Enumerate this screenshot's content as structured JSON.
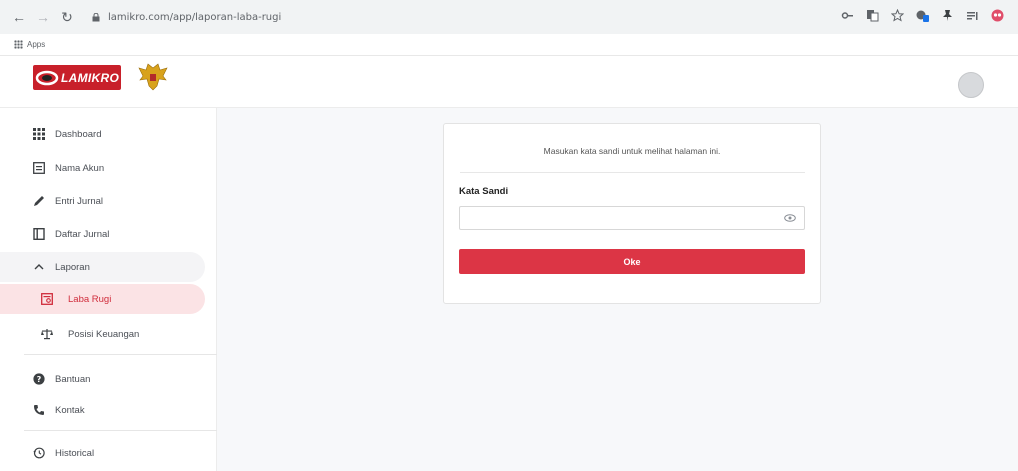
{
  "browser": {
    "url": "lamikro.com/app/laporan-laba-rugi",
    "bookmarks": {
      "apps_label": "Apps"
    }
  },
  "header": {
    "logo_text": "LAMIKRO"
  },
  "sidebar": {
    "items": [
      {
        "label": "Dashboard",
        "icon": "grid-icon"
      },
      {
        "label": "Nama Akun",
        "icon": "list-icon"
      },
      {
        "label": "Entri Jurnal",
        "icon": "pencil-icon"
      },
      {
        "label": "Daftar Jurnal",
        "icon": "book-icon"
      },
      {
        "label": "Laporan",
        "icon": "chevron-up-icon"
      },
      {
        "label": "Laba Rugi",
        "icon": "report-icon"
      },
      {
        "label": "Posisi Keuangan",
        "icon": "scale-icon"
      },
      {
        "label": "Bantuan",
        "icon": "help-icon"
      },
      {
        "label": "Kontak",
        "icon": "phone-icon"
      },
      {
        "label": "Historical",
        "icon": "history-icon"
      }
    ]
  },
  "main": {
    "message": "Masukan kata sandi untuk melihat halaman ini.",
    "password_label": "Kata Sandi",
    "password_value": "",
    "submit_label": "Oke"
  },
  "colors": {
    "accent": "#dc3545",
    "active_bg": "#fbe3e5",
    "logo_red": "#c8202a"
  }
}
